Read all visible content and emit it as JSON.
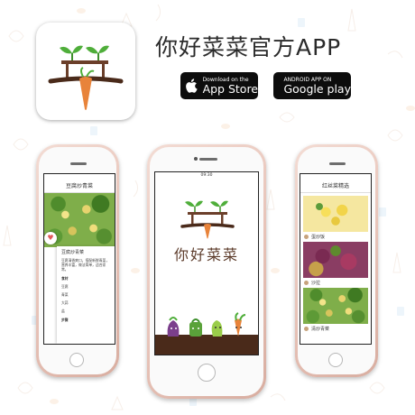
{
  "app": {
    "title": "你好菜菜官方APP"
  },
  "stores": {
    "apple": {
      "small": "Download on the",
      "big": "App Store",
      "icon": "apple-icon"
    },
    "google": {
      "small": "ANDROID APP ON",
      "big": "Google play",
      "icon": "google-play-icon"
    }
  },
  "phones": {
    "left": {
      "nav_title": "豆腐炒青菜",
      "heading": "豆腐炒青菜",
      "intro": "豆腐清香爽口，搭配新鲜青菜，营养丰富，做法简单，适合家常。",
      "ingredients_label": "食材",
      "ingredients": [
        "豆腐",
        "青菜",
        "大蒜",
        "盐"
      ],
      "steps_label": "步骤"
    },
    "center": {
      "time": "09:30",
      "brand": "你好菜菜"
    },
    "right": {
      "nav_title": "红丝菜精选",
      "items": [
        "蛋炒饭",
        "沙拉",
        "清炒青菜"
      ]
    }
  },
  "colors": {
    "brand_brown": "#5b3a29",
    "leaf_green": "#4fae3a",
    "carrot_orange": "#e8833a",
    "soil": "#4a2a1a"
  }
}
